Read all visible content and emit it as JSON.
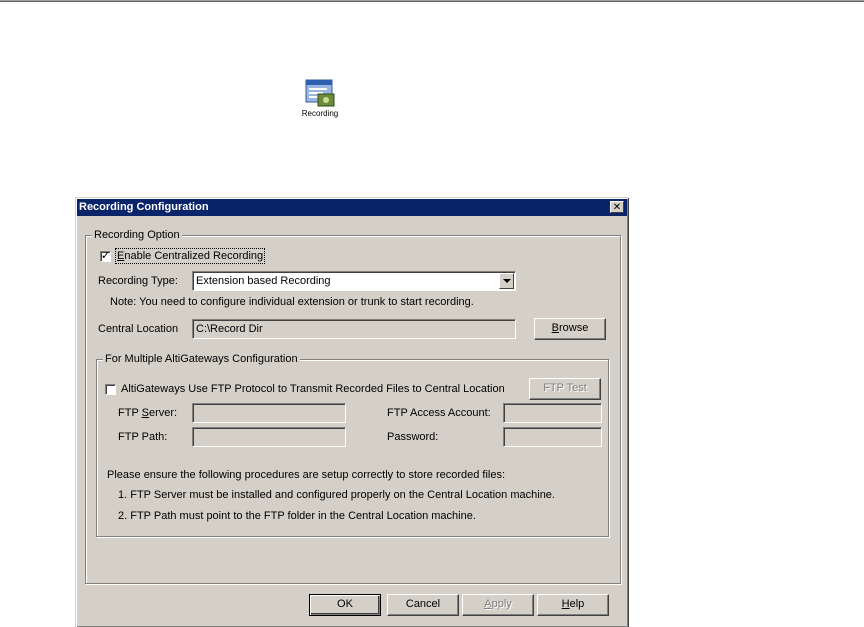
{
  "desktop": {
    "icon_caption": "Recording",
    "icon": "recording-icon"
  },
  "dialog": {
    "title": "Recording Configuration",
    "recording_option": {
      "legend": "Recording Option",
      "enable_label_prefix": "",
      "enable_label_u": "E",
      "enable_label_rest": "nable Centralized Recording",
      "enable_checked": true,
      "type_label": "Recording Type:",
      "type_value": "Extension based Recording",
      "note": "Note: You need to configure individual extension or trunk to start recording.",
      "central_label": "Central Location",
      "central_value": "C:\\Record Dir",
      "browse_u": "B",
      "browse_rest": "rowse"
    },
    "multi": {
      "legend": "For Multiple AltiGateways Configuration",
      "ftp_checkbox_label": "AltiGateways Use FTP Protocol to Transmit Recorded Files to Central Location",
      "ftp_checked": false,
      "ftp_test_label": "FTP Test",
      "ftp_server_pre": "FTP ",
      "ftp_server_u": "S",
      "ftp_server_rest": "erver:",
      "ftp_server_value": "",
      "ftp_account_label": "FTP Access Account:",
      "ftp_account_value": "",
      "ftp_path_label": "FTP Path:",
      "ftp_path_value": "",
      "password_label": "Password:",
      "password_value": "",
      "instructions": "Please ensure the following procedures are setup correctly to store recorded files:",
      "step1": "1. FTP Server must be installed and configured properly on the Central Location machine.",
      "step2": "2. FTP Path must point to the FTP folder in the Central Location machine."
    },
    "buttons": {
      "ok": "OK",
      "cancel": "Cancel",
      "apply_u": "A",
      "apply_rest": "pply",
      "help_u": "H",
      "help_rest": "elp"
    }
  }
}
